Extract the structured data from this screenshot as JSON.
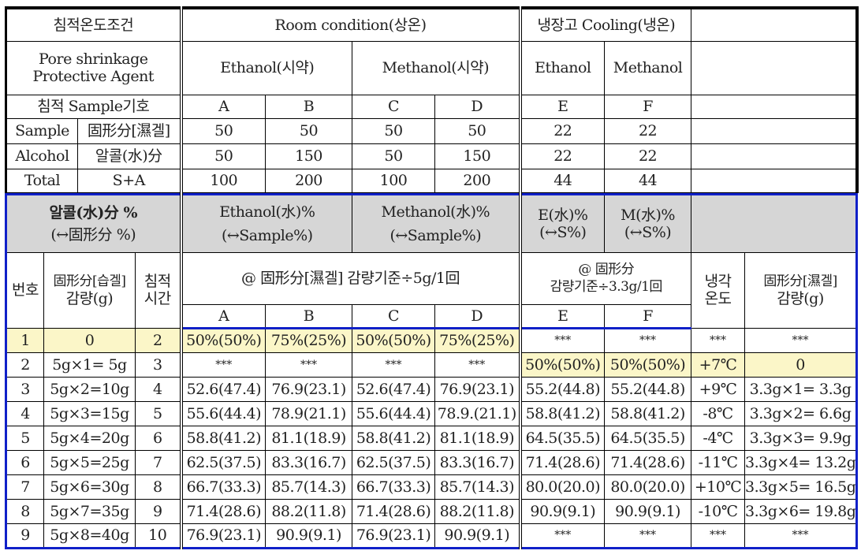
{
  "top": {
    "condition_label": "침적온도조건",
    "room_condition": "Room  condition(상온)",
    "cooling": "냉장고  Cooling(냉온)",
    "agent_label_1": "Pore  shrinkage",
    "agent_label_2": "Protective  Agent",
    "ethanol_reagent": "Ethanol(시약)",
    "methanol_reagent": "Methanol(시약)",
    "ethanol": "Ethanol",
    "methanol": "Methanol",
    "sample_code_label": "침적  Sample기호",
    "codes": [
      "A",
      "B",
      "C",
      "D",
      "E",
      "F"
    ],
    "rows": [
      {
        "label1": "Sample",
        "label2": "固形分[濕겔]",
        "values": [
          "50",
          "50",
          "50",
          "50",
          "22",
          "22"
        ]
      },
      {
        "label1": "Alcohol",
        "label2": "알콜(水)分",
        "values": [
          "50",
          "150",
          "50",
          "150",
          "22",
          "22"
        ]
      },
      {
        "label1": "Total",
        "label2": "S+A",
        "values": [
          "100",
          "200",
          "100",
          "200",
          "44",
          "44"
        ]
      }
    ]
  },
  "bottom": {
    "pct_label_1": "알콜(水)分 %",
    "pct_label_2": "(↔固形分 %)",
    "eth_pct_1": "Ethanol(水)%",
    "eth_pct_2": "(↔Sample%)",
    "meth_pct_1": "Methanol(水)%",
    "meth_pct_2": "(↔Sample%)",
    "e_pct_1": "E(水)%",
    "e_pct_2": "(↔S%)",
    "m_pct_1": "M(水)%",
    "m_pct_2": "(↔S%)",
    "no_label": "번호",
    "reduce_label_1": "固形分[습겔]",
    "reduce_label_2": "감량(g)",
    "time_label_1": "침적",
    "time_label_2": "시간",
    "room_basis": "@  固形分[濕겔]  감량기준÷5g/1回",
    "cool_basis_1": "@  固形分",
    "cool_basis_2": "감량기준÷3.3g/1回",
    "cool_temp_1": "냉각",
    "cool_temp_2": "온도",
    "cool_reduce_1": "固形分[濕겔]",
    "cool_reduce_2": "감량(g)",
    "codes": [
      "A",
      "B",
      "C",
      "D",
      "E",
      "F"
    ],
    "rows": [
      {
        "no": "1",
        "reduce": "0",
        "time": "2",
        "a": "50%(50%)",
        "b": "75%(25%)",
        "c": "50%(50%)",
        "d": "75%(25%)",
        "e": "***",
        "f": "***",
        "temp": "***",
        "creduce": "***"
      },
      {
        "no": "2",
        "reduce": "5g×1=  5g",
        "time": "3",
        "a": "***",
        "b": "***",
        "c": "***",
        "d": "***",
        "e": "50%(50%)",
        "f": "50%(50%)",
        "temp": "+7℃",
        "creduce": "0"
      },
      {
        "no": "3",
        "reduce": "5g×2=10g",
        "time": "4",
        "a": "52.6(47.4)",
        "b": "76.9(23.1)",
        "c": "52.6(47.4)",
        "d": "76.9(23.1)",
        "e": "55.2(44.8)",
        "f": "55.2(44.8)",
        "temp": "+9℃",
        "creduce": "3.3g×1=  3.3g"
      },
      {
        "no": "4",
        "reduce": "5g×3=15g",
        "time": "5",
        "a": "55.6(44.4)",
        "b": "78.9(21.1)",
        "c": "55.6(44.4)",
        "d": "78.9.(21.1)",
        "e": "58.8(41.2)",
        "f": "58.8(41.2)",
        "temp": "-8℃",
        "creduce": "3.3g×2=  6.6g"
      },
      {
        "no": "5",
        "reduce": "5g×4=20g",
        "time": "6",
        "a": "58.8(41.2)",
        "b": "81.1(18.9)",
        "c": "58.8(41.2)",
        "d": "81.1(18.9)",
        "e": "64.5(35.5)",
        "f": "64.5(35.5)",
        "temp": "-4℃",
        "creduce": "3.3g×3=  9.9g"
      },
      {
        "no": "6",
        "reduce": "5g×5=25g",
        "time": "7",
        "a": "62.5(37.5)",
        "b": "83.3(16.7)",
        "c": "62.5(37.5)",
        "d": "83.3(16.7)",
        "e": "71.4(28.6)",
        "f": "71.4(28.6)",
        "temp": "-11℃",
        "creduce": "3.3g×4=  13.2g"
      },
      {
        "no": "7",
        "reduce": "5g×6=30g",
        "time": "8",
        "a": "66.7(33.3)",
        "b": "85.7(14.3)",
        "c": "66.7(33.3)",
        "d": "85.7(14.3)",
        "e": "80.0(20.0)",
        "f": "80.0(20.0)",
        "temp": "+10℃",
        "creduce": "3.3g×5=  16.5g"
      },
      {
        "no": "8",
        "reduce": "5g×7=35g",
        "time": "9",
        "a": "71.4(28.6)",
        "b": "88.2(11.8)",
        "c": "71.4(28.6)",
        "d": "88.2(11.8)",
        "e": "90.9(9.1)",
        "f": "90.9(9.1)",
        "temp": "-10℃",
        "creduce": "3.3g×6=  19.8g"
      },
      {
        "no": "9",
        "reduce": "5g×8=40g",
        "time": "10",
        "a": "76.9(23.1)",
        "b": "90.9(9.1)",
        "c": "76.9(23.1)",
        "d": "90.9(9.1)",
        "e": "***",
        "f": "***",
        "temp": "***",
        "creduce": "***"
      }
    ]
  }
}
